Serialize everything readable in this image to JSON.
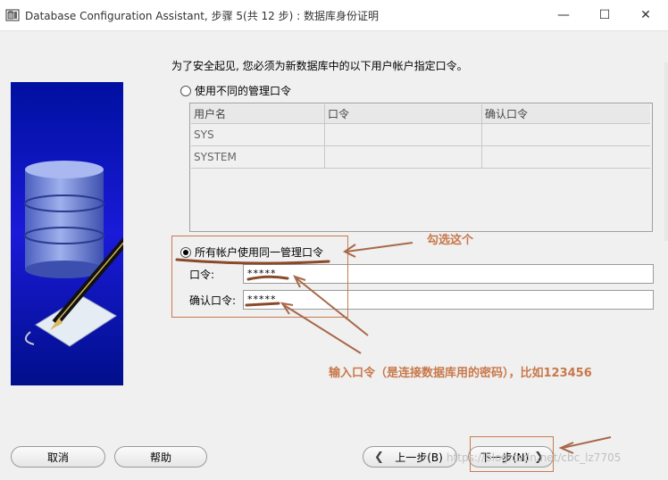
{
  "window": {
    "title": "Database Configuration Assistant, 步骤 5(共 12 步) : 数据库身份证明",
    "minimize_glyph": "—",
    "maximize_glyph": "☐",
    "close_glyph": "✕",
    "icon": "database-app-icon"
  },
  "main": {
    "instruction": "为了安全起见, 您必须为新数据库中的以下用户帐户指定口令。",
    "option_different": {
      "label": "使用不同的管理口令",
      "selected": false
    },
    "table": {
      "headers": [
        "用户名",
        "口令",
        "确认口令"
      ],
      "rows": [
        [
          "SYS",
          "",
          ""
        ],
        [
          "SYSTEM",
          "",
          ""
        ]
      ]
    },
    "option_same": {
      "label": "所有帐户使用同一管理口令",
      "selected": true
    },
    "password": {
      "label": "口令:",
      "value": "*****"
    },
    "confirm": {
      "label": "确认口令:",
      "value": "*****"
    }
  },
  "buttons": {
    "cancel": "取消",
    "help": "帮助",
    "back": "上一步(B)",
    "next": "下一步(N)",
    "back_icon": "chevron-left-icon",
    "next_icon": "chevron-right-icon"
  },
  "annotations": {
    "select_this": "勾选这个",
    "enter_password": "输入口令（是连接数据库用的密码），比如123456",
    "color": "#c8784a"
  },
  "watermark": "https://blog.csdn.net/cbc_lz7705"
}
